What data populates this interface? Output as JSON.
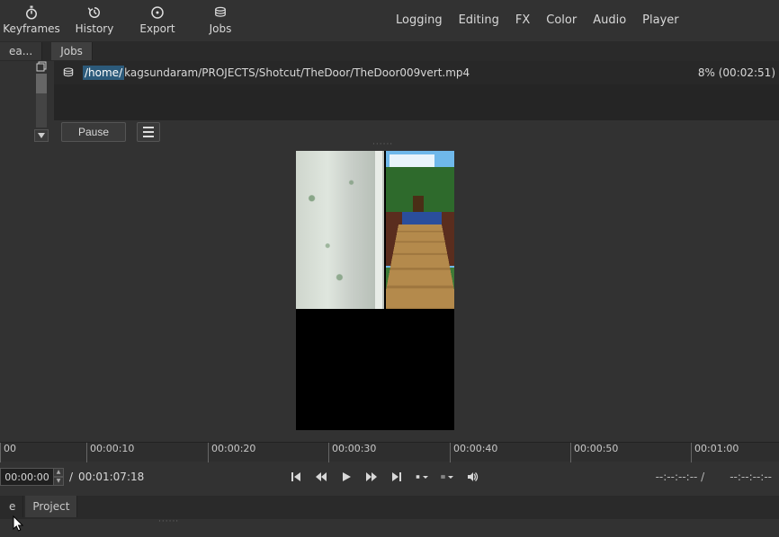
{
  "toolbar": {
    "keyframes": "Keyframes",
    "history": "History",
    "export": "Export",
    "jobs": "Jobs"
  },
  "menus": {
    "logging": "Logging",
    "editing": "Editing",
    "fx": "FX",
    "color": "Color",
    "audio": "Audio",
    "player": "Player"
  },
  "tabs": {
    "left_trunc": "ea...",
    "jobs": "Jobs"
  },
  "file": {
    "path_sel": "/home/",
    "path_rest": "kagsundaram/PROJECTS/Shotcut/TheDoor/TheDoor009vert.mp4",
    "progress": "8% (00:02:51)"
  },
  "controls": {
    "pause": "Pause"
  },
  "ruler": {
    "ticks": [
      "00",
      "00:00:10",
      "00:00:20",
      "00:00:30",
      "00:00:40",
      "00:00:50",
      "00:01:00"
    ]
  },
  "timecode": {
    "current": "00:00:00",
    "duration": "00:01:07:18",
    "right1": "--:--:--:-- /",
    "right2": "--:--:--:--"
  },
  "bottom": {
    "left_trunc": "e",
    "project": "Project"
  }
}
